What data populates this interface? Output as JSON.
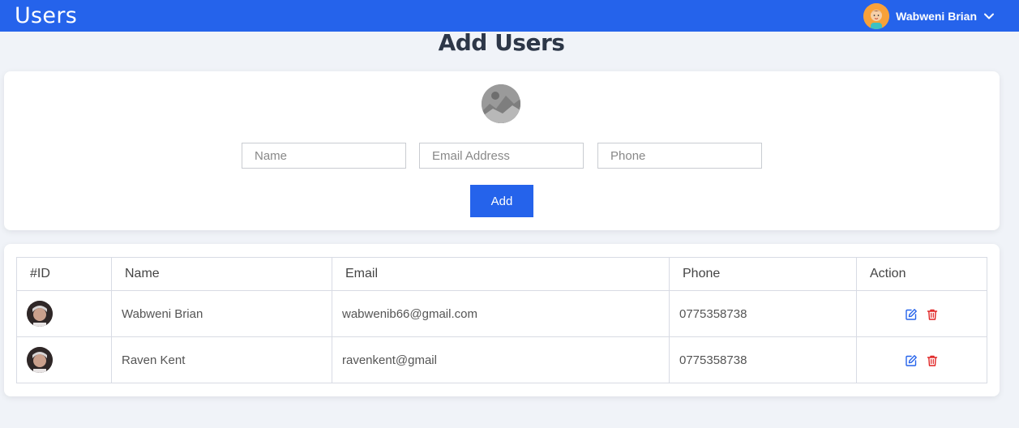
{
  "header": {
    "app_title": "Users",
    "user_name": "Wabweni Brian",
    "accent_color": "#2563eb"
  },
  "page": {
    "heading": "Add Users"
  },
  "form": {
    "name_placeholder": "Name",
    "email_placeholder": "Email Address",
    "phone_placeholder": "Phone",
    "add_label": "Add"
  },
  "table": {
    "columns": [
      "#ID",
      "Name",
      "Email",
      "Phone",
      "Action"
    ],
    "rows": [
      {
        "name": "Wabweni Brian",
        "email": "wabwenib66@gmail.com",
        "phone": "0775358738"
      },
      {
        "name": "Raven Kent",
        "email": "ravenkent@gmail",
        "phone": "0775358738"
      }
    ],
    "edit_color": "#2563eb",
    "delete_color": "#e02424"
  }
}
